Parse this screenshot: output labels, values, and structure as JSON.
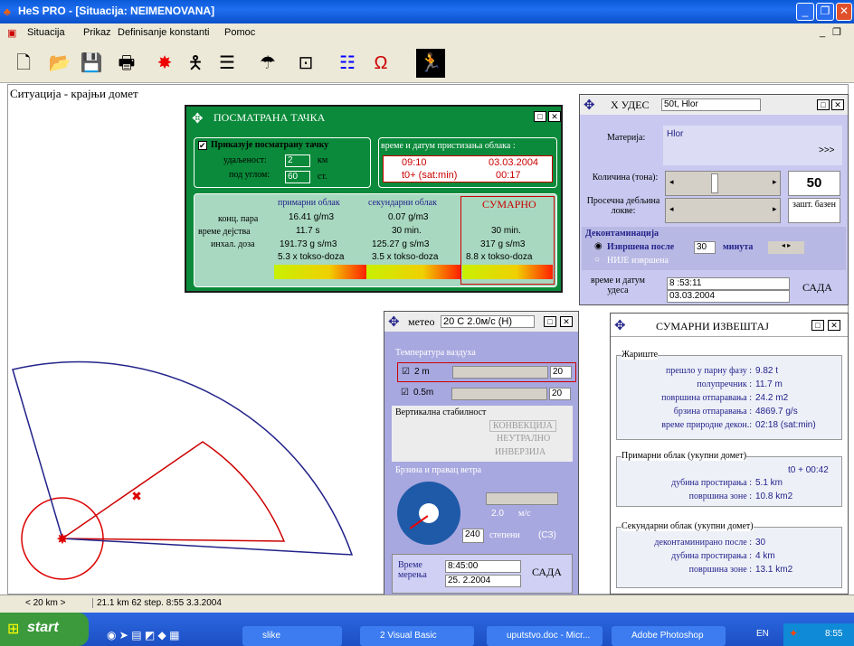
{
  "title": "HeS PRO - [Situacija: NEIMENOVANA]",
  "menu": [
    "Situacija",
    "Prikaz",
    "Definisanje konstanti",
    "Pomoc"
  ],
  "canvas_title": "Ситуација - крајњи домет",
  "observation": {
    "title": "ПОСМАТРАНА ТАЧКА",
    "show_label": "Приказује посматрану тачку",
    "distance_label": "удаљеност:",
    "distance": "2",
    "distance_unit": "км",
    "angle_label": "под углом:",
    "angle": "60",
    "angle_unit": "ст.",
    "arrival_title": "време и датум пристизања облака :",
    "arrival_time": "09:10",
    "arrival_date": "03.03.2004",
    "arrival_rel": "t0+ (sat:min)",
    "arrival_rel_val": "00:17",
    "col_primary": "примарни облак",
    "col_secondary": "секундарни облак",
    "col_total": "СУМАРНО",
    "row_labels": [
      "конц. пара",
      "време дејства",
      "инхал. доза"
    ],
    "primary": [
      "16.41 g/m3",
      "11.7 s",
      "191.73 g s/m3",
      "5.3 x tokso-doza"
    ],
    "secondary": [
      "0.07 g/m3",
      "30 min.",
      "125.27 g s/m3",
      "3.5 x tokso-doza"
    ],
    "total": [
      "",
      "30 min.",
      "317 g s/m3",
      "8.8 x tokso-doza"
    ]
  },
  "accident": {
    "title": "Х УДЕС",
    "name": "50t, Hlor",
    "material_label": "Материја:",
    "material": "Hlor",
    "more": ">>>",
    "qty_label": "Количина (тона):",
    "qty": "50",
    "depth_label": "Просечна дебљина локве:",
    "basin": "зашт. базен",
    "decon_title": "Деконтаминација",
    "decon_done": "Извршена после",
    "decon_minutes": "30",
    "decon_unit": "минута",
    "decon_not": "НИЈЕ извршена",
    "time_label": "време и датум удеса",
    "time": "8 :53:11",
    "date": "03.03.2004",
    "now": "САДА"
  },
  "meteo": {
    "title": "метео",
    "summary": "20 C     2.0м/с (Н)",
    "temp_title": "Температура ваздуха",
    "t2_label": "2 m",
    "t2": "20",
    "t05_label": "0.5m",
    "t05": "20",
    "stab_title": "Вертикална стабилност",
    "stab_opts": [
      "КОНВЕКЦИЈА",
      "НЕУТРАЛНО",
      "ИНВЕРЗИЈА"
    ],
    "wind_title": "Брзина и правац ветра",
    "wind_speed": "2.0",
    "wind_unit": "м/с",
    "wind_dir": "240",
    "wind_dir_label": "степени",
    "wind_dir_name": "(СЗ)",
    "meas_label": "Време мерења",
    "meas_time": "8:45:00",
    "meas_date": "25. 2.2004",
    "now": "САДА"
  },
  "summary": {
    "title": "СУМАРНИ ИЗВЕШТАЈ",
    "g1": "Жариште",
    "g1_rows": [
      [
        "прешло у парну фазу :",
        "9.82 t"
      ],
      [
        "полупречник :",
        "11.7 m"
      ],
      [
        "површина отпаравања :",
        "24.2 m2"
      ],
      [
        "брзина отпаравања :",
        "4869.7 g/s"
      ],
      [
        "време природне декон.:",
        "02:18 (sat:min)"
      ]
    ],
    "g2": "Примарни облак (укупни домет)",
    "g2_t": "t0 + 00:42",
    "g2_rows": [
      [
        "дубина простирања :",
        "5.1 km"
      ],
      [
        "површина зоне :",
        "10.8 km2"
      ]
    ],
    "g3": "Секундарни облак (укупни домет)",
    "g3_rows": [
      [
        "деконтаминирано после :",
        "30"
      ],
      [
        "дубина простирања :",
        "4 km"
      ],
      [
        "површина зоне :",
        "13.1 km2"
      ]
    ]
  },
  "status": {
    "scale": "< 20 km >",
    "info": "21.1 km  62 step.  8:55  3.3.2004"
  },
  "taskbar": {
    "start": "start",
    "tasks": [
      "slike",
      "2 Visual Basic",
      "uputstvo.doc - Micr...",
      "Adobe Photoshop"
    ],
    "lang": "EN",
    "clock": "8:55"
  },
  "colors": {
    "panel_green": "#0a8a3a",
    "red": "#cc0000",
    "blue": "#22228a"
  }
}
